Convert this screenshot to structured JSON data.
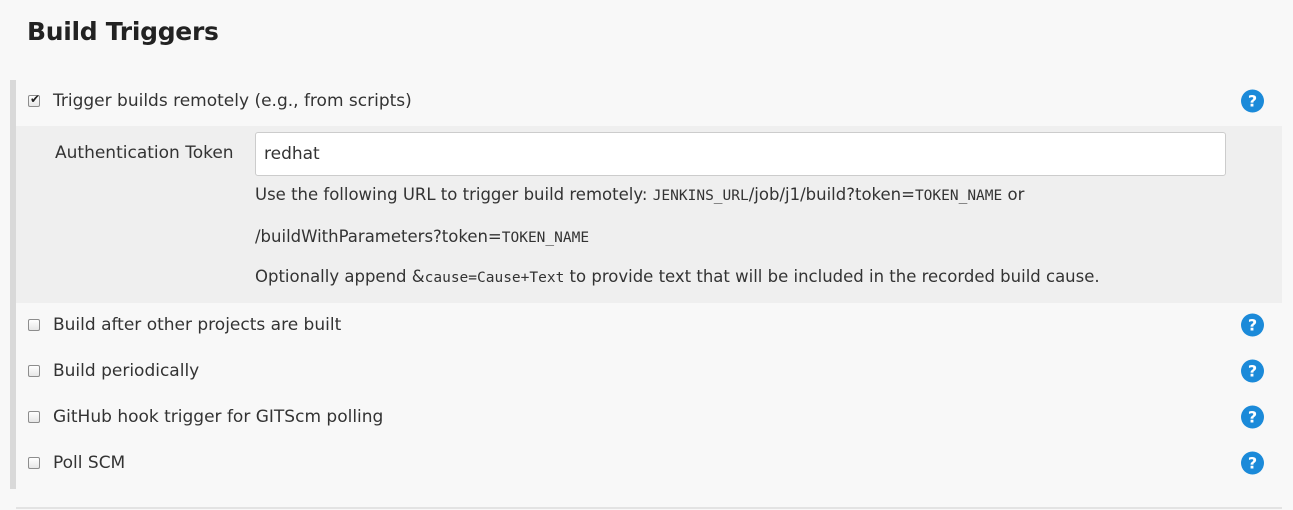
{
  "section": {
    "title": "Build Triggers"
  },
  "triggers": [
    {
      "label": "Trigger builds remotely (e.g., from scripts)",
      "checked": true,
      "help_icon": "question-circle-icon"
    },
    {
      "label": "Build after other projects are built",
      "checked": false,
      "help_icon": "question-circle-icon"
    },
    {
      "label": "Build periodically",
      "checked": false,
      "help_icon": "question-circle-icon"
    },
    {
      "label": "GitHub hook trigger for GITScm polling",
      "checked": false,
      "help_icon": "question-circle-icon"
    },
    {
      "label": "Poll SCM",
      "checked": false,
      "help_icon": "question-circle-icon"
    }
  ],
  "remote": {
    "token_label": "Authentication Token",
    "token_value": "redhat",
    "help_line1": {
      "prefix": "Use the following URL to trigger build remotely: ",
      "code1": "JENKINS_URL",
      "mid": "/job/j1/build?token=",
      "code2": "TOKEN_NAME",
      "suffix": " or"
    },
    "help_line2": {
      "prefix": "/buildWithParameters?token=",
      "code": "TOKEN_NAME"
    },
    "help_line3": {
      "prefix": "Optionally append ",
      "amp": "&",
      "code": "cause=Cause+Text",
      "suffix": " to provide text that will be included in the recorded build cause."
    }
  },
  "help_glyph": "?",
  "check_glyph": "✔",
  "colors": {
    "help_icon": "#1b8ad9",
    "page_background": "#f8f8f8",
    "sub_panel_background": "#efefef"
  }
}
